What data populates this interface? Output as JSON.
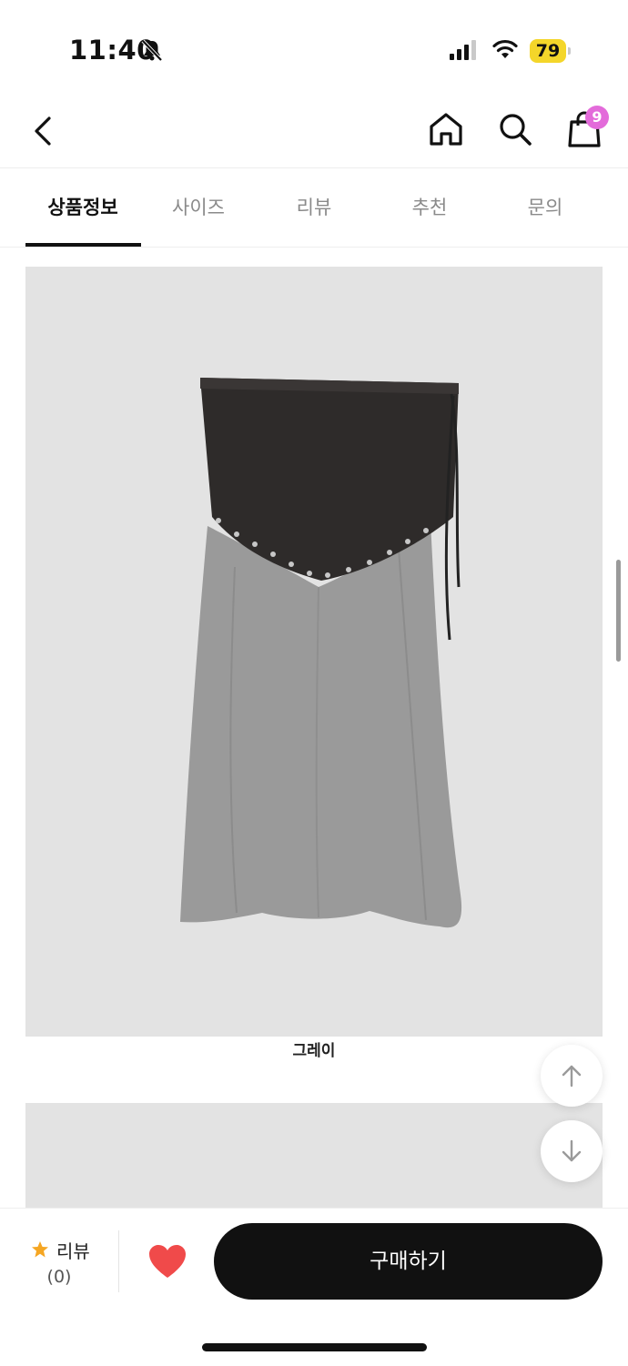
{
  "status": {
    "time": "11:40",
    "battery": "79"
  },
  "header": {
    "cart_count": "9"
  },
  "tabs": [
    {
      "label": "상품정보",
      "active": true
    },
    {
      "label": "사이즈",
      "active": false
    },
    {
      "label": "리뷰",
      "active": false
    },
    {
      "label": "추천",
      "active": false
    },
    {
      "label": "문의",
      "active": false
    }
  ],
  "content": {
    "caption": "그레이"
  },
  "bottom_bar": {
    "review_label": "리뷰",
    "review_count": "(0)",
    "buy_label": "구매하기"
  },
  "colors": {
    "accent_badge": "#e36bda",
    "star": "#f5a623",
    "heart": "#f04a4a",
    "buy_button": "#111111"
  }
}
